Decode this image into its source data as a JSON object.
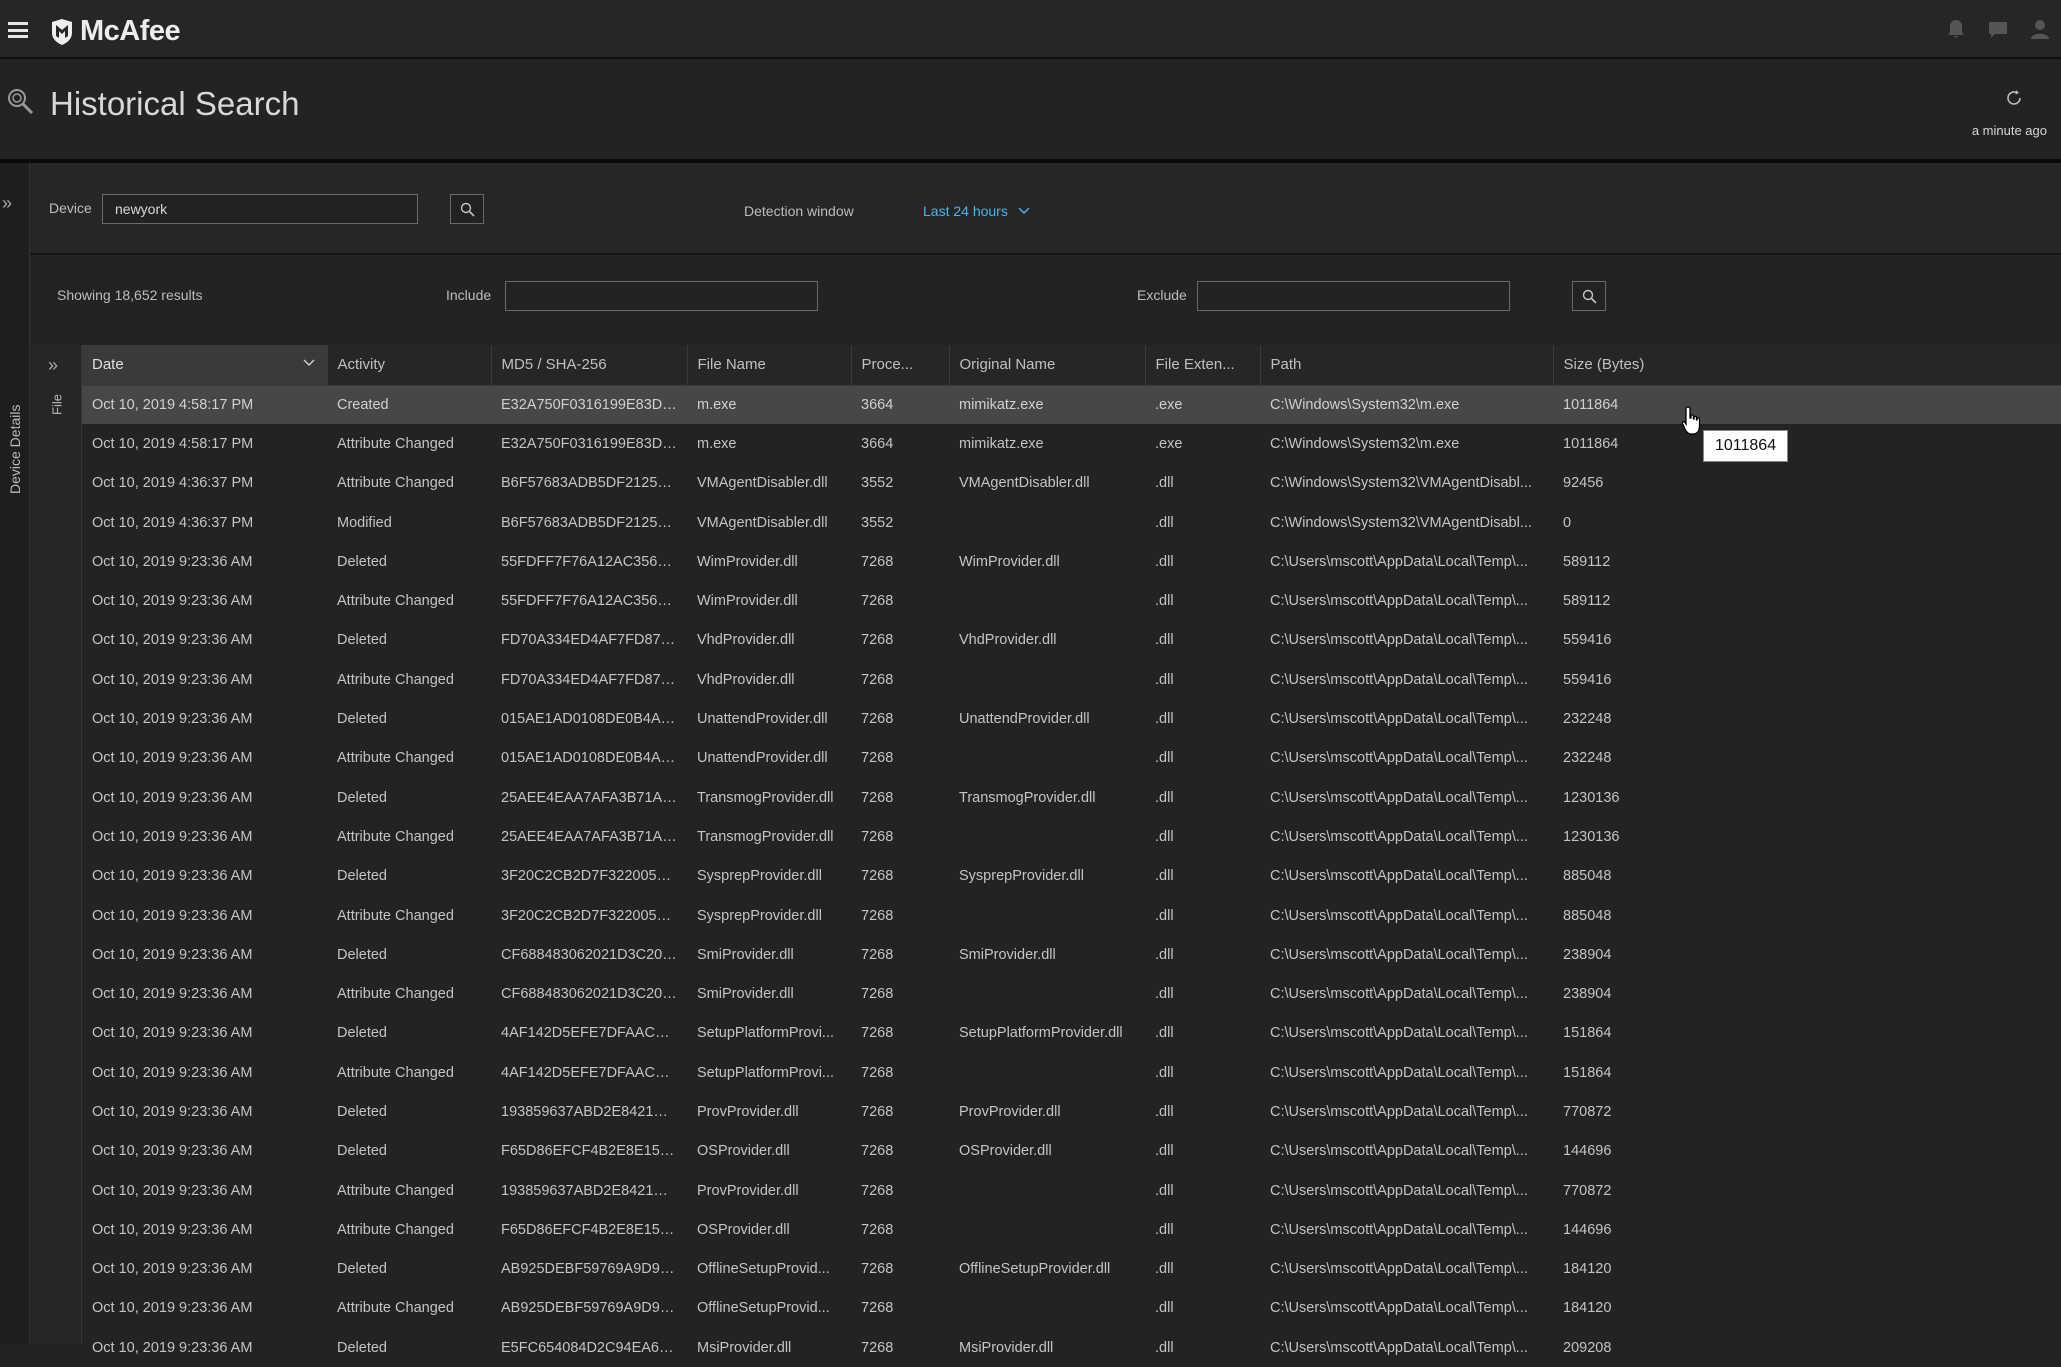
{
  "app": {
    "brand": "McAfee",
    "page_title": "Historical Search",
    "updated": "a minute ago"
  },
  "side_rail": {
    "label": "Device Details"
  },
  "filters": {
    "device_label": "Device",
    "device_value": "newyork",
    "detection_label": "Detection window",
    "detection_value": "Last 24 hours",
    "include_label": "Include",
    "include_value": "",
    "exclude_label": "Exclude",
    "exclude_value": ""
  },
  "results": {
    "summary": "Showing 18,652 results"
  },
  "grid": {
    "side_tab": "File",
    "columns": [
      "Date",
      "Activity",
      "MD5 / SHA-256",
      "File Name",
      "Proce...",
      "Original Name",
      "File Exten...",
      "Path",
      "Size (Bytes)"
    ],
    "rows": [
      [
        "Oct 10, 2019 4:58:17 PM",
        "Created",
        "E32A750F0316199E83D5...",
        "m.exe",
        "3664",
        "mimikatz.exe",
        ".exe",
        "C:\\Windows\\System32\\m.exe",
        "1011864"
      ],
      [
        "Oct 10, 2019 4:58:17 PM",
        "Attribute Changed",
        "E32A750F0316199E83D5...",
        "m.exe",
        "3664",
        "mimikatz.exe",
        ".exe",
        "C:\\Windows\\System32\\m.exe",
        "1011864"
      ],
      [
        "Oct 10, 2019 4:36:37 PM",
        "Attribute Changed",
        "B6F57683ADB5DF21253...",
        "VMAgentDisabler.dll",
        "3552",
        "VMAgentDisabler.dll",
        ".dll",
        "C:\\Windows\\System32\\VMAgentDisabl...",
        "92456"
      ],
      [
        "Oct 10, 2019 4:36:37 PM",
        "Modified",
        "B6F57683ADB5DF21253...",
        "VMAgentDisabler.dll",
        "3552",
        "",
        ".dll",
        "C:\\Windows\\System32\\VMAgentDisabl...",
        "0"
      ],
      [
        "Oct 10, 2019 9:23:36 AM",
        "Deleted",
        "55FDFF7F76A12AC35633...",
        "WimProvider.dll",
        "7268",
        "WimProvider.dll",
        ".dll",
        "C:\\Users\\mscott\\AppData\\Local\\Temp\\...",
        "589112"
      ],
      [
        "Oct 10, 2019 9:23:36 AM",
        "Attribute Changed",
        "55FDFF7F76A12AC35633...",
        "WimProvider.dll",
        "7268",
        "",
        ".dll",
        "C:\\Users\\mscott\\AppData\\Local\\Temp\\...",
        "589112"
      ],
      [
        "Oct 10, 2019 9:23:36 AM",
        "Deleted",
        "FD70A334ED4AF7FD872...",
        "VhdProvider.dll",
        "7268",
        "VhdProvider.dll",
        ".dll",
        "C:\\Users\\mscott\\AppData\\Local\\Temp\\...",
        "559416"
      ],
      [
        "Oct 10, 2019 9:23:36 AM",
        "Attribute Changed",
        "FD70A334ED4AF7FD872...",
        "VhdProvider.dll",
        "7268",
        "",
        ".dll",
        "C:\\Users\\mscott\\AppData\\Local\\Temp\\...",
        "559416"
      ],
      [
        "Oct 10, 2019 9:23:36 AM",
        "Deleted",
        "015AE1AD0108DE0B4AD...",
        "UnattendProvider.dll",
        "7268",
        "UnattendProvider.dll",
        ".dll",
        "C:\\Users\\mscott\\AppData\\Local\\Temp\\...",
        "232248"
      ],
      [
        "Oct 10, 2019 9:23:36 AM",
        "Attribute Changed",
        "015AE1AD0108DE0B4AD...",
        "UnattendProvider.dll",
        "7268",
        "",
        ".dll",
        "C:\\Users\\mscott\\AppData\\Local\\Temp\\...",
        "232248"
      ],
      [
        "Oct 10, 2019 9:23:36 AM",
        "Deleted",
        "25AEE4EAA7AFA3B71AC...",
        "TransmogProvider.dll",
        "7268",
        "TransmogProvider.dll",
        ".dll",
        "C:\\Users\\mscott\\AppData\\Local\\Temp\\...",
        "1230136"
      ],
      [
        "Oct 10, 2019 9:23:36 AM",
        "Attribute Changed",
        "25AEE4EAA7AFA3B71AC...",
        "TransmogProvider.dll",
        "7268",
        "",
        ".dll",
        "C:\\Users\\mscott\\AppData\\Local\\Temp\\...",
        "1230136"
      ],
      [
        "Oct 10, 2019 9:23:36 AM",
        "Deleted",
        "3F20C2CB2D7F32200502...",
        "SysprepProvider.dll",
        "7268",
        "SysprepProvider.dll",
        ".dll",
        "C:\\Users\\mscott\\AppData\\Local\\Temp\\...",
        "885048"
      ],
      [
        "Oct 10, 2019 9:23:36 AM",
        "Attribute Changed",
        "3F20C2CB2D7F32200502...",
        "SysprepProvider.dll",
        "7268",
        "",
        ".dll",
        "C:\\Users\\mscott\\AppData\\Local\\Temp\\...",
        "885048"
      ],
      [
        "Oct 10, 2019 9:23:36 AM",
        "Deleted",
        "CF688483062021D3C209...",
        "SmiProvider.dll",
        "7268",
        "SmiProvider.dll",
        ".dll",
        "C:\\Users\\mscott\\AppData\\Local\\Temp\\...",
        "238904"
      ],
      [
        "Oct 10, 2019 9:23:36 AM",
        "Attribute Changed",
        "CF688483062021D3C209...",
        "SmiProvider.dll",
        "7268",
        "",
        ".dll",
        "C:\\Users\\mscott\\AppData\\Local\\Temp\\...",
        "238904"
      ],
      [
        "Oct 10, 2019 9:23:36 AM",
        "Deleted",
        "4AF142D5EFE7DFAAC4B...",
        "SetupPlatformProvi...",
        "7268",
        "SetupPlatformProvider.dll",
        ".dll",
        "C:\\Users\\mscott\\AppData\\Local\\Temp\\...",
        "151864"
      ],
      [
        "Oct 10, 2019 9:23:36 AM",
        "Attribute Changed",
        "4AF142D5EFE7DFAAC4B...",
        "SetupPlatformProvi...",
        "7268",
        "",
        ".dll",
        "C:\\Users\\mscott\\AppData\\Local\\Temp\\...",
        "151864"
      ],
      [
        "Oct 10, 2019 9:23:36 AM",
        "Deleted",
        "193859637ABD2E8421AE...",
        "ProvProvider.dll",
        "7268",
        "ProvProvider.dll",
        ".dll",
        "C:\\Users\\mscott\\AppData\\Local\\Temp\\...",
        "770872"
      ],
      [
        "Oct 10, 2019 9:23:36 AM",
        "Deleted",
        "F65D86EFCF4B2E8E1532...",
        "OSProvider.dll",
        "7268",
        "OSProvider.dll",
        ".dll",
        "C:\\Users\\mscott\\AppData\\Local\\Temp\\...",
        "144696"
      ],
      [
        "Oct 10, 2019 9:23:36 AM",
        "Attribute Changed",
        "193859637ABD2E8421AE...",
        "ProvProvider.dll",
        "7268",
        "",
        ".dll",
        "C:\\Users\\mscott\\AppData\\Local\\Temp\\...",
        "770872"
      ],
      [
        "Oct 10, 2019 9:23:36 AM",
        "Attribute Changed",
        "F65D86EFCF4B2E8E1532...",
        "OSProvider.dll",
        "7268",
        "",
        ".dll",
        "C:\\Users\\mscott\\AppData\\Local\\Temp\\...",
        "144696"
      ],
      [
        "Oct 10, 2019 9:23:36 AM",
        "Deleted",
        "AB925DEBF59769A9D94...",
        "OfflineSetupProvid...",
        "7268",
        "OfflineSetupProvider.dll",
        ".dll",
        "C:\\Users\\mscott\\AppData\\Local\\Temp\\...",
        "184120"
      ],
      [
        "Oct 10, 2019 9:23:36 AM",
        "Attribute Changed",
        "AB925DEBF59769A9D94...",
        "OfflineSetupProvid...",
        "7268",
        "",
        ".dll",
        "C:\\Users\\mscott\\AppData\\Local\\Temp\\...",
        "184120"
      ],
      [
        "Oct 10, 2019 9:23:36 AM",
        "Deleted",
        "E5FC654084D2C94EA663...",
        "MsiProvider.dll",
        "7268",
        "MsiProvider.dll",
        ".dll",
        "C:\\Users\\mscott\\AppData\\Local\\Temp\\...",
        "209208"
      ]
    ],
    "selected_row": 0
  },
  "tooltip": {
    "text": "1011864"
  },
  "colors": {
    "accent": "#4fb4e6",
    "background": "#232323",
    "selected_row": "#474747"
  }
}
